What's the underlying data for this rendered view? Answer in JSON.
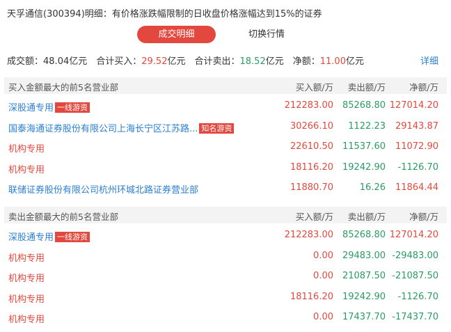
{
  "header": {
    "title": "天孚通信(300394)明细：有价格涨跌幅限制的日收盘价格涨幅达到15%的证券"
  },
  "tabs": {
    "active": "成交明细",
    "other": "切换行情"
  },
  "summary": {
    "volume_label": "成交额：",
    "volume_value": "48.04亿元",
    "buy_label": "合计买入：",
    "buy_value": "29.52",
    "buy_unit": "亿元",
    "sell_label": "合计卖出：",
    "sell_value": "18.52",
    "sell_unit": "亿元",
    "net_label": "净额：",
    "net_value": "11.00",
    "net_unit": "亿元",
    "detail_link": "详细"
  },
  "buy_section": {
    "title": "买入金额最大的前5名营业部",
    "col_buy": "买入额/万",
    "col_sell": "卖出额/万",
    "col_net": "净额/万",
    "rows": [
      {
        "name": "深股通专用",
        "tag": "一线游资",
        "buy": "212283.00",
        "sell": "85268.80",
        "net": "127014.20"
      },
      {
        "name": "国泰海通证券股份有限公司上海长宁区江苏路...",
        "tag": "知名游资",
        "buy": "30266.10",
        "sell": "1122.23",
        "net": "29143.87"
      },
      {
        "name": "机构专用",
        "tag": "",
        "buy": "22610.50",
        "sell": "11537.60",
        "net": "11072.90"
      },
      {
        "name": "机构专用",
        "tag": "",
        "buy": "18116.20",
        "sell": "19242.90",
        "net": "-1126.70"
      },
      {
        "name": "联储证券股份有限公司杭州环城北路证券营业部",
        "tag": "",
        "buy": "11880.70",
        "sell": "16.26",
        "net": "11864.44"
      }
    ]
  },
  "sell_section": {
    "title": "卖出金额最大的前5名营业部",
    "col_buy": "买入额/万",
    "col_sell": "卖出额/万",
    "col_net": "净额/万",
    "rows": [
      {
        "name": "深股通专用",
        "tag": "一线游资",
        "buy": "212283.00",
        "sell": "85268.80",
        "net": "127014.20"
      },
      {
        "name": "机构专用",
        "tag": "",
        "buy": "0.00",
        "sell": "29483.00",
        "net": "-29483.00"
      },
      {
        "name": "机构专用",
        "tag": "",
        "buy": "0.00",
        "sell": "21087.50",
        "net": "-21087.50"
      },
      {
        "name": "机构专用",
        "tag": "",
        "buy": "18116.20",
        "sell": "19242.90",
        "net": "-1126.70"
      },
      {
        "name": "机构专用",
        "tag": "",
        "buy": "0.00",
        "sell": "17437.70",
        "net": "-17437.70"
      }
    ]
  },
  "colors": {
    "accent_red": "#e2483d",
    "green": "#2a9b63",
    "link_blue": "#2b7fd0"
  }
}
